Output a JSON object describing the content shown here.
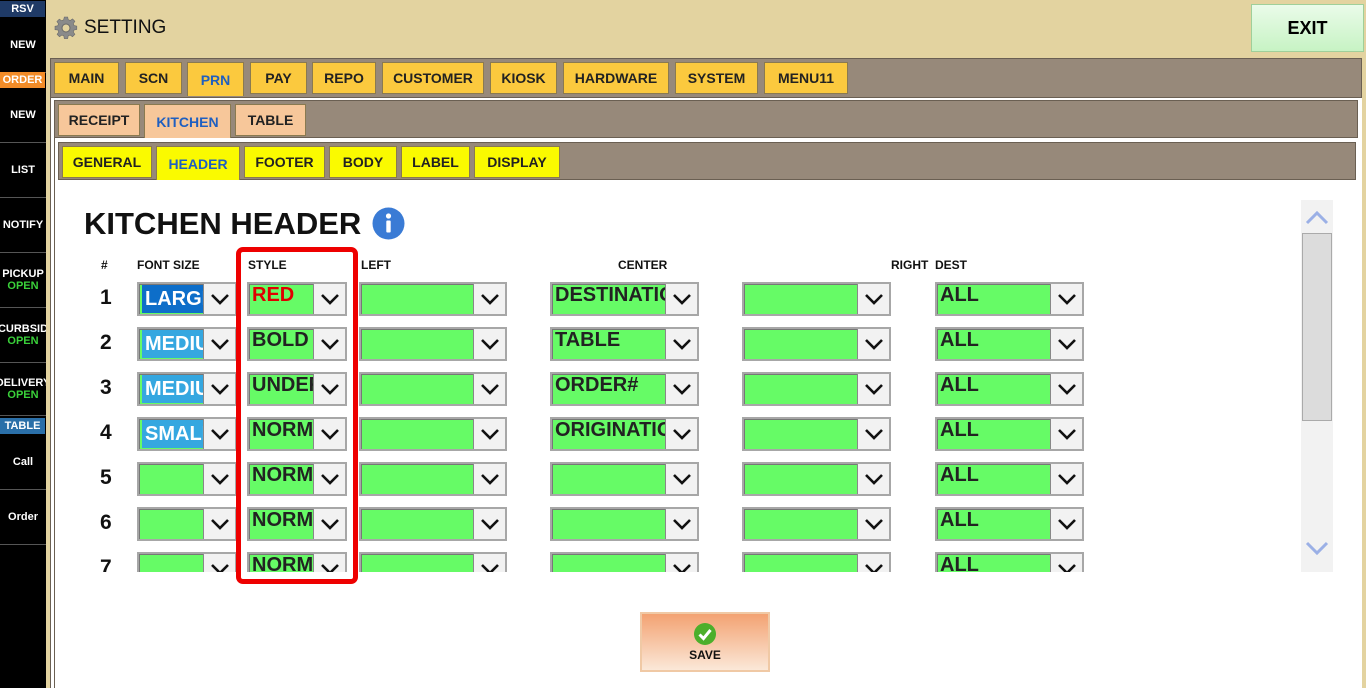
{
  "sidebar": {
    "rsv_header": "RSV",
    "order_header": "ORDER",
    "table_header": "TABLE",
    "items": [
      {
        "label": "NEW",
        "sub": ""
      },
      {
        "label": "NEW",
        "sub": ""
      },
      {
        "label": "LIST",
        "sub": ""
      },
      {
        "label": "NOTIFY",
        "sub": ""
      },
      {
        "label": "PICKUP",
        "sub": "OPEN"
      },
      {
        "label": "CURBSID",
        "sub": "OPEN"
      },
      {
        "label": "DELIVERY",
        "sub": "OPEN"
      },
      {
        "label": "Call",
        "sub": ""
      },
      {
        "label": "Order",
        "sub": ""
      }
    ],
    "colors": {
      "rsv": "#1f3a66",
      "order": "#f28c28",
      "table": "#2a6fa8",
      "open": "#3ad13a"
    }
  },
  "titlebar": {
    "title": "SETTING",
    "icon": "gear-icon",
    "exit_label": "EXIT"
  },
  "tabs_main": [
    {
      "label": "MAIN",
      "active": false
    },
    {
      "label": "SCN",
      "active": false
    },
    {
      "label": "PRN",
      "active": true
    },
    {
      "label": "PAY",
      "active": false
    },
    {
      "label": "REPO",
      "active": false
    },
    {
      "label": "CUSTOMER",
      "active": false
    },
    {
      "label": "KIOSK",
      "active": false
    },
    {
      "label": "HARDWARE",
      "active": false
    },
    {
      "label": "SYSTEM",
      "active": false
    },
    {
      "label": "MENU11",
      "active": false
    }
  ],
  "tabs_prn": [
    {
      "label": "RECEIPT",
      "active": false
    },
    {
      "label": "KITCHEN",
      "active": true
    },
    {
      "label": "TABLE",
      "active": false
    }
  ],
  "tabs_kitchen": [
    {
      "label": "GENERAL",
      "active": false
    },
    {
      "label": "HEADER",
      "active": true
    },
    {
      "label": "FOOTER",
      "active": false
    },
    {
      "label": "BODY",
      "active": false
    },
    {
      "label": "LABEL",
      "active": false
    },
    {
      "label": "DISPLAY",
      "active": false
    }
  ],
  "panel": {
    "title": "KITCHEN HEADER",
    "info_icon": "info-icon",
    "columns": {
      "num": "#",
      "font_size": "FONT SIZE",
      "style": "STYLE",
      "left": "LEFT",
      "center": "CENTER",
      "right": "RIGHT",
      "dest": "DEST"
    },
    "rows": [
      {
        "num": "1",
        "font_size": "LARGE",
        "font_color": "#0d6ec9",
        "style": "RED",
        "style_color": "#e00000",
        "left": "",
        "center": "DESTINATION",
        "right": "",
        "dest": "ALL"
      },
      {
        "num": "2",
        "font_size": "MEDIUM",
        "font_color": "#35a7e0",
        "style": "BOLD",
        "style_color": "#222222",
        "left": "",
        "center": "TABLE",
        "right": "",
        "dest": "ALL"
      },
      {
        "num": "3",
        "font_size": "MEDIUM",
        "font_color": "#35a7e0",
        "style": "UNDERLINE",
        "style_color": "#222222",
        "left": "",
        "center": "ORDER#",
        "right": "",
        "dest": "ALL"
      },
      {
        "num": "4",
        "font_size": "SMALL",
        "font_color": "#35a7e0",
        "style": "NORMAL",
        "style_color": "#222222",
        "left": "",
        "center": "ORIGINATION",
        "right": "",
        "dest": "ALL"
      },
      {
        "num": "5",
        "font_size": "",
        "font_color": "",
        "style": "NORMAL",
        "style_color": "#222222",
        "left": "",
        "center": "",
        "right": "",
        "dest": "ALL"
      },
      {
        "num": "6",
        "font_size": "",
        "font_color": "",
        "style": "NORMAL",
        "style_color": "#222222",
        "left": "",
        "center": "",
        "right": "",
        "dest": "ALL"
      },
      {
        "num": "7",
        "font_size": "",
        "font_color": "",
        "style": "NORMAL",
        "style_color": "#222222",
        "left": "",
        "center": "",
        "right": "",
        "dest": "ALL"
      }
    ],
    "save_label": "SAVE"
  }
}
